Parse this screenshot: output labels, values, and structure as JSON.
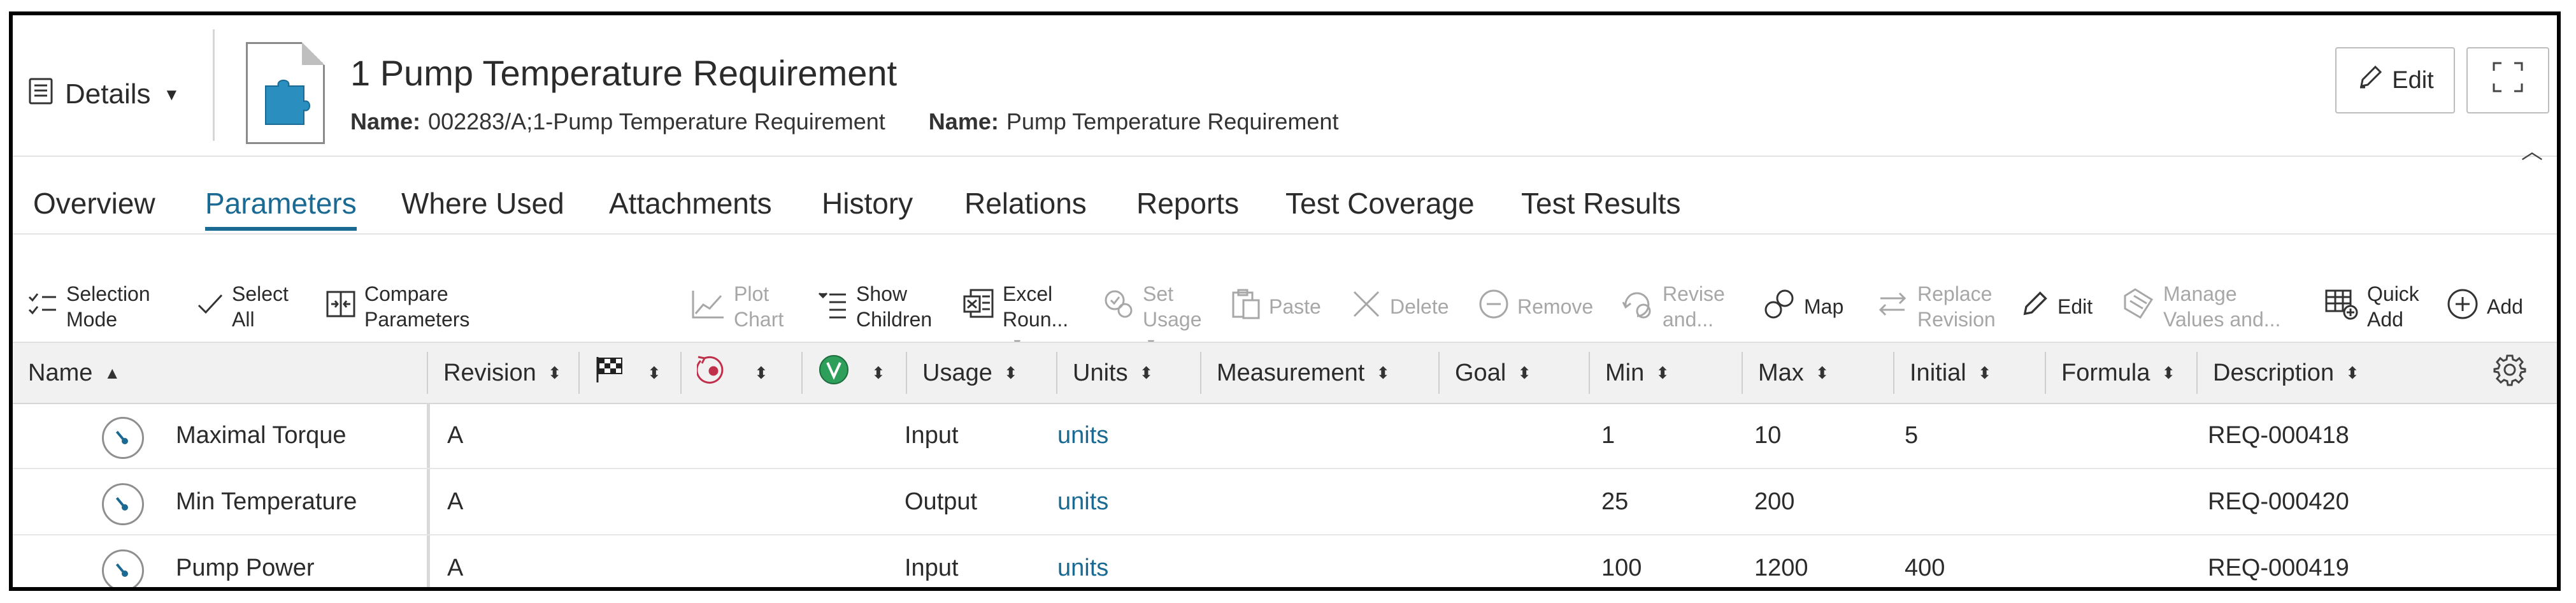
{
  "header": {
    "view_menu": "Details",
    "title": "1 Pump Temperature Requirement",
    "name_label_1": "Name:",
    "name_value_1": "002283/A;1-Pump Temperature Requirement",
    "name_label_2": "Name:",
    "name_value_2": "Pump Temperature Requirement",
    "edit_label": "Edit"
  },
  "tabs": [
    {
      "label": "Overview"
    },
    {
      "label": "Parameters"
    },
    {
      "label": "Where Used"
    },
    {
      "label": "Attachments"
    },
    {
      "label": "History"
    },
    {
      "label": "Relations"
    },
    {
      "label": "Reports"
    },
    {
      "label": "Test Coverage"
    },
    {
      "label": "Test Results"
    }
  ],
  "toolbar": {
    "selection_mode": [
      "Selection",
      "Mode"
    ],
    "select_all": [
      "Select",
      "All"
    ],
    "compare_parameters": [
      "Compare",
      "Parameters"
    ],
    "plot_chart": [
      "Plot",
      "Chart"
    ],
    "show_children": [
      "Show",
      "Children"
    ],
    "excel_round": [
      "Excel",
      "Roun..."
    ],
    "set_usage": [
      "Set",
      "Usage"
    ],
    "paste": "Paste",
    "delete": "Delete",
    "remove": "Remove",
    "revise_and": [
      "Revise",
      "and..."
    ],
    "map": "Map",
    "replace_revision": [
      "Replace",
      "Revision"
    ],
    "edit": "Edit",
    "manage_values": [
      "Manage",
      "Values and..."
    ],
    "quick_add": [
      "Quick",
      "Add"
    ],
    "add": "Add"
  },
  "table": {
    "columns": {
      "name": "Name",
      "revision": "Revision",
      "usage": "Usage",
      "units": "Units",
      "measurement": "Measurement",
      "goal": "Goal",
      "min": "Min",
      "max": "Max",
      "initial": "Initial",
      "formula": "Formula",
      "description": "Description"
    },
    "rows": [
      {
        "name": "Maximal Torque",
        "revision": "A",
        "usage": "Input",
        "units": "units",
        "min": "1",
        "max": "10",
        "initial": "5",
        "description": "REQ-000418"
      },
      {
        "name": "Min Temperature",
        "revision": "A",
        "usage": "Output",
        "units": "units",
        "min": "25",
        "max": "200",
        "initial": "",
        "description": "REQ-000420"
      },
      {
        "name": "Pump Power",
        "revision": "A",
        "usage": "Input",
        "units": "units",
        "min": "100",
        "max": "1200",
        "initial": "400",
        "description": "REQ-000419"
      }
    ]
  },
  "colors": {
    "accent": "#1a6a93",
    "puzzle_icon": "#2a8fbf",
    "validation_badge": "#2e9e5b",
    "constraint_icon": "#c0304a"
  }
}
